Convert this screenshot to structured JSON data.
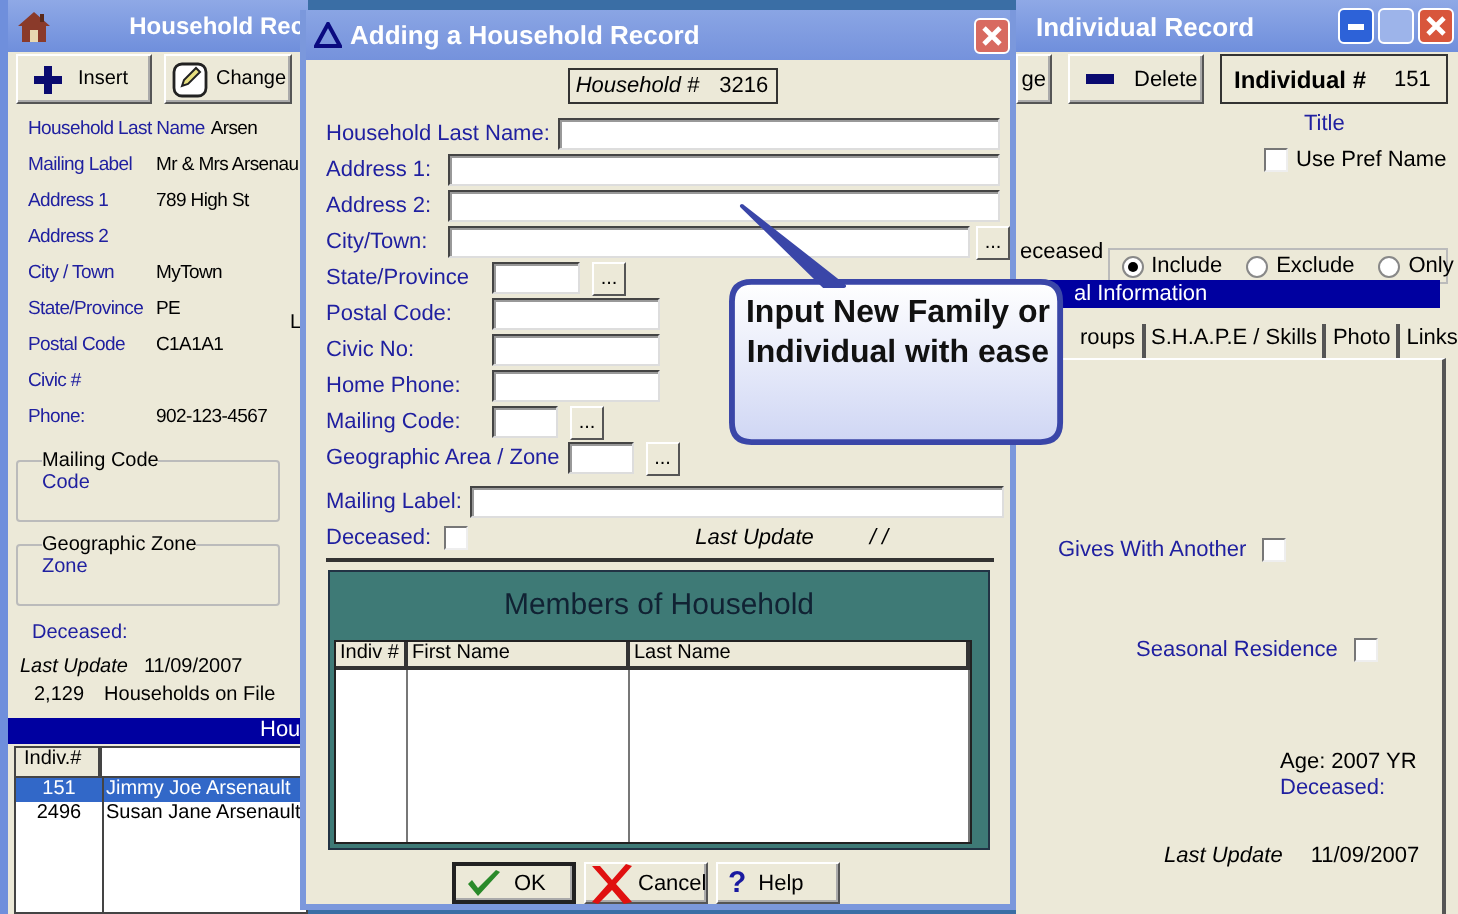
{
  "household_window": {
    "title": "Household Rec",
    "toolbar": [
      {
        "label": "Insert",
        "kind": "insert"
      },
      {
        "label": "Change",
        "kind": "change"
      }
    ],
    "fields": [
      {
        "label": "Household Last Name",
        "value": "Arsen"
      },
      {
        "label": "Mailing Label",
        "value": "Mr & Mrs Arsenau"
      },
      {
        "label": "Address 1",
        "value": "789 High St"
      },
      {
        "label": "Address 2"
      },
      {
        "label": "City / Town",
        "value": "MyTown"
      },
      {
        "label": "State/Province",
        "value": "PE"
      },
      {
        "label": "Postal Code",
        "value": "C1A1A1"
      },
      {
        "label": "Civic #"
      },
      {
        "label": "Phone:",
        "value": "902-123-4567"
      }
    ],
    "groups": [
      {
        "title": "Mailing Code",
        "value": "Code"
      },
      {
        "title": "Geographic Zone",
        "value": "Zone"
      }
    ],
    "side_label": "L",
    "deceased": "Deceased:",
    "last_update": {
      "label": "Last Update",
      "value": "11/09/2007"
    },
    "households": {
      "count": "2,129",
      "label": "Households on File"
    },
    "members_bar": "Hou",
    "members": {
      "columns": [
        "Indiv.#"
      ],
      "rows": [
        {
          "number": "151",
          "name": "Jimmy Joe Arsenault",
          "selected": true
        },
        {
          "number": "2496",
          "name": "Susan Jane Arsenault",
          "selected": false
        }
      ]
    }
  },
  "individual_window": {
    "title": "Individual Record",
    "toolbar": [
      {
        "label": "ge",
        "kind": "plain"
      },
      {
        "label": "Delete",
        "kind": "delete"
      }
    ],
    "individual_number": {
      "label": "Individual #",
      "value": "151"
    },
    "title_label": "Title",
    "use_pref_name": {
      "label": "Use Pref Name",
      "checked": false
    },
    "deceased_filter": {
      "label": "eceased",
      "options": [
        {
          "label": "Include",
          "selected": true
        },
        {
          "label": "Exclude",
          "selected": false
        },
        {
          "label": "Only",
          "selected": false
        }
      ]
    },
    "section_bar": "al Information",
    "tabs": [
      {
        "label": "roups",
        "selected": false
      },
      {
        "label": "S.H.A.P.E / Skills",
        "selected": false
      },
      {
        "label": "Photo",
        "selected": false
      },
      {
        "label": "Links",
        "selected": false
      }
    ],
    "gives_with_another": {
      "label": "Gives With Another",
      "checked": false
    },
    "seasonal_residence": {
      "label": "Seasonal Residence",
      "checked": false
    },
    "age": "Age: 2007 YR",
    "deceased": "Deceased:",
    "last_update": {
      "label": "Last Update",
      "value": "11/09/2007"
    }
  },
  "dialog": {
    "title": "Adding a Household Record",
    "household_number": {
      "label": "Household #",
      "value": "3216"
    },
    "fields": [
      {
        "label": "Household Last Name:",
        "kind": "line"
      },
      {
        "label": "Address 1:",
        "kind": "line"
      },
      {
        "label": "Address 2:",
        "kind": "line"
      },
      {
        "label": "City/Town:",
        "kind": "line",
        "button": "..."
      },
      {
        "label": "State/Province",
        "kind": "small",
        "button": "..."
      },
      {
        "label": "Postal Code:",
        "kind": "medium"
      },
      {
        "label": "Civic No:",
        "kind": "medium"
      },
      {
        "label": "Home Phone:",
        "kind": "medium"
      },
      {
        "label": "Mailing Code:",
        "kind": "tiny",
        "button": "..."
      },
      {
        "label": "Geographic  Area / Zone",
        "kind": "tiny",
        "button": "..."
      }
    ],
    "mailing_label": {
      "label": "Mailing Label:"
    },
    "deceased": {
      "label": "Deceased:",
      "checked": false
    },
    "last_update": {
      "label": "Last Update",
      "value": "/ /"
    },
    "members": {
      "title": "Members of Household",
      "columns": [
        "Indiv #",
        "First Name",
        "Last Name"
      ]
    },
    "buttons": [
      {
        "label": "OK",
        "kind": "ok"
      },
      {
        "label": "Cancel",
        "kind": "cancel"
      },
      {
        "label": "Help",
        "kind": "help",
        "glyph": "?"
      }
    ]
  },
  "callout": {
    "text": "Input New Family or Individual with ease"
  }
}
